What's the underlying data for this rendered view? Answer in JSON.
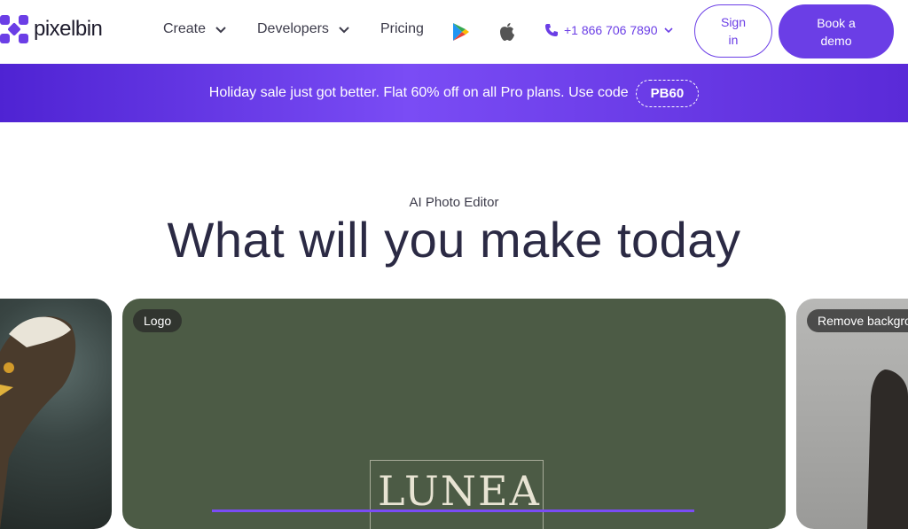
{
  "brand": {
    "name": "pixelbin",
    "accent": "#6b3ee6"
  },
  "nav": {
    "items": [
      {
        "label": "Create",
        "has_dropdown": true
      },
      {
        "label": "Developers",
        "has_dropdown": true
      },
      {
        "label": "Pricing",
        "has_dropdown": false
      }
    ],
    "store_icons": [
      "google-play-icon",
      "apple-icon"
    ],
    "phone": "+1 866 706 7890",
    "sign_in": "Sign in",
    "book_demo": "Book a demo"
  },
  "banner": {
    "text": "Holiday sale just got better. Flat 60% off on all Pro plans. Use code",
    "code": "PB60"
  },
  "hero": {
    "eyebrow": "AI Photo Editor",
    "title": "What will you make today"
  },
  "cards": [
    {
      "tag": "",
      "image": "eagle"
    },
    {
      "tag": "Logo",
      "image": "lunea-logo",
      "logo_text": "LUNEA"
    },
    {
      "tag": "Remove backgro",
      "image": "person"
    }
  ]
}
